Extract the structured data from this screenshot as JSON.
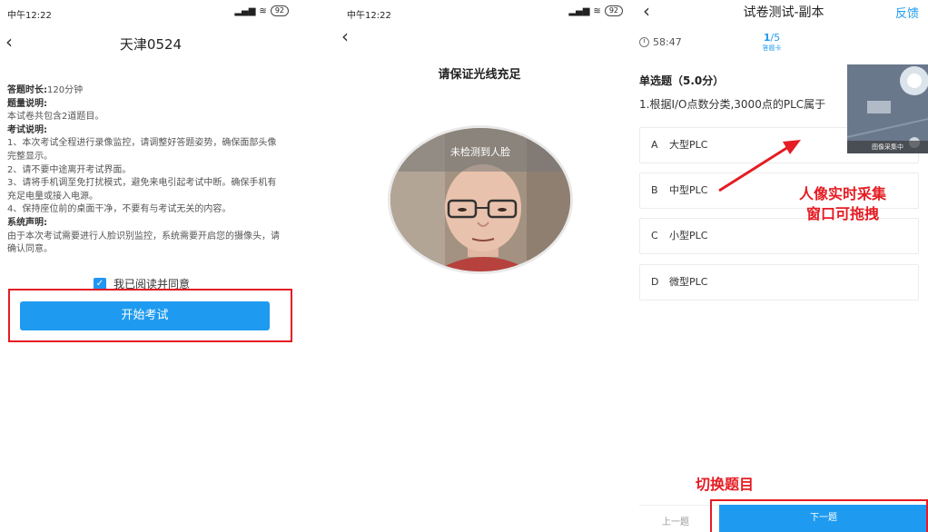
{
  "panel1": {
    "status_time": "中午12:22",
    "battery": "92",
    "title": "天津0524",
    "rules": {
      "duration_label": "答题时长:",
      "duration_value": "120分钟",
      "desc_label": "题量说明:",
      "desc_text": "本试卷共包含2道题目。",
      "exam_label": "考试说明:",
      "exam_items": [
        "1、本次考试全程进行录像监控，请调整好答题姿势，确保面部头像完整显示。",
        "2、请不要中途离开考试界面。",
        "3、请将手机调至免打扰模式，避免来电引起考试中断。确保手机有充足电量或接入电源。",
        "4、保持座位前的桌面干净，不要有与考试无关的内容。"
      ],
      "system_label": "系统声明:",
      "system_text": "由于本次考试需要进行人脸识别监控，系统需要开启您的摄像头，请确认同意。"
    },
    "agree_label": "我已阅读并同意",
    "start_button": "开始考试"
  },
  "panel2": {
    "status_time": "中午12:22",
    "battery": "92",
    "hint": "请保证光线充足",
    "face_status": "未检测到人脸"
  },
  "panel3": {
    "title": "试卷测试-副本",
    "feedback": "反馈",
    "timer": "58:47",
    "progress_current": "1",
    "progress_total": "/5",
    "answer_card": "答题卡",
    "question_type": "单选题（5.0分）",
    "question": "1.根据I/O点数分类,3000点的PLC属于",
    "options": [
      {
        "letter": "A",
        "text": "大型PLC"
      },
      {
        "letter": "B",
        "text": "中型PLC"
      },
      {
        "letter": "C",
        "text": "小型PLC"
      },
      {
        "letter": "D",
        "text": "微型PLC"
      }
    ],
    "camera_caption": "图像采集中",
    "annotation_camera_line1": "人像实时采集",
    "annotation_camera_line2": "窗口可拖拽",
    "annotation_switch": "切换题目",
    "prev_button": "上一题",
    "next_button": "下一题"
  },
  "colors": {
    "accent": "#1e9bf0",
    "annotation_red": "#e51c23"
  }
}
